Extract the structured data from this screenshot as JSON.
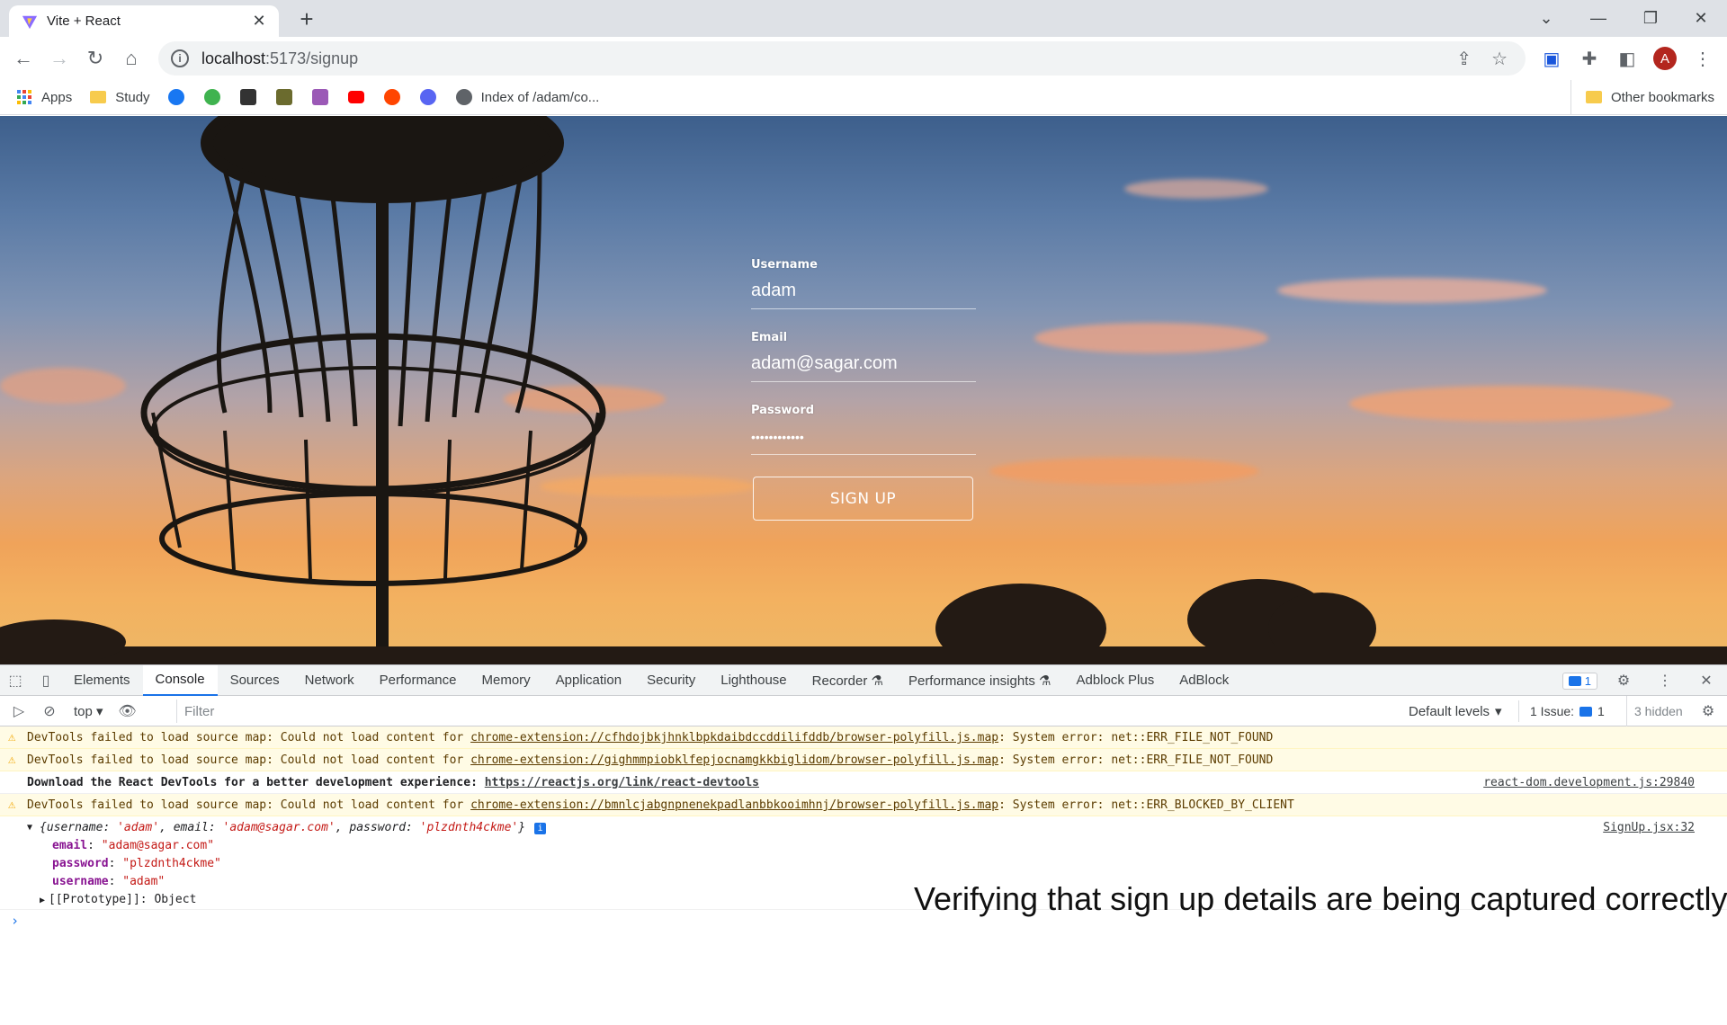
{
  "browser": {
    "tab_title": "Vite + React",
    "url_host": "localhost",
    "url_rest": ":5173/signup",
    "profile_initial": "A"
  },
  "bookmarks": {
    "apps": "Apps",
    "study": "Study",
    "index": "Index of /adam/co...",
    "other": "Other bookmarks",
    "icons": [
      "facebook-icon",
      "vine-icon",
      "ghost-icon",
      "ninja-icon",
      "s-icon",
      "youtube-icon",
      "reddit-icon",
      "discord-icon",
      "globe-icon"
    ]
  },
  "signup": {
    "username_label": "Username",
    "username_value": "adam",
    "email_label": "Email",
    "email_value": "adam@sagar.com",
    "password_label": "Password",
    "password_value": "plzdnth4ckme",
    "button": "SIGN UP"
  },
  "devtools": {
    "tabs": [
      "Elements",
      "Console",
      "Sources",
      "Network",
      "Performance",
      "Memory",
      "Application",
      "Security",
      "Lighthouse",
      "Recorder ⚗",
      "Performance insights ⚗",
      "Adblock Plus",
      "AdBlock"
    ],
    "active_tab": "Console",
    "messages_badge": "1",
    "context": "top",
    "filter_placeholder": "Filter",
    "levels": "Default levels",
    "issues": "1 Issue:",
    "issues_count": "1",
    "hidden": "3 hidden"
  },
  "console": {
    "w1_text": "DevTools failed to load source map: Could not load content for ",
    "w1_link": "chrome-extension://cfhdojbkjhnklbpkdaibdccddilifddb/browser-polyfill.js.map",
    "w1_tail": ": System error: net::ERR_FILE_NOT_FOUND",
    "w2_text": "DevTools failed to load source map: Could not load content for ",
    "w2_link": "chrome-extension://gighmmpiobklfepjocnamgkkbiglidom/browser-polyfill.js.map",
    "w2_tail": ": System error: net::ERR_FILE_NOT_FOUND",
    "info_text": "Download the React DevTools for a better development experience: ",
    "info_link": "https://reactjs.org/link/react-devtools",
    "info_src": "react-dom.development.js:29840",
    "w3_text": "DevTools failed to load source map: Could not load content for ",
    "w3_link": "chrome-extension://bmnlcjabgnpnenekpadlanbbkooimhnj/browser-polyfill.js.map",
    "w3_tail": ": System error: net::ERR_BLOCKED_BY_CLIENT",
    "obj_src": "SignUp.jsx:32",
    "obj_summary_open": "{username: ",
    "obj_summary_user": "'adam'",
    "obj_summary_email_k": ", email: ",
    "obj_summary_email": "'adam@sagar.com'",
    "obj_summary_pw_k": ", password: ",
    "obj_summary_pw": "'plzdnth4ckme'",
    "obj_summary_close": "}",
    "email_key": "email",
    "email_val": "\"adam@sagar.com\"",
    "password_key": "password",
    "password_val": "\"plzdnth4ckme\"",
    "username_key": "username",
    "username_val": "\"adam\"",
    "proto_key": "[[Prototype]]",
    "proto_val": "Object"
  },
  "caption": "Verifying that sign up details are being captured correctly.",
  "colors": {
    "accent": "#1a73e8",
    "warning_bg": "#fffbe5",
    "avatar": "#b3261e"
  }
}
